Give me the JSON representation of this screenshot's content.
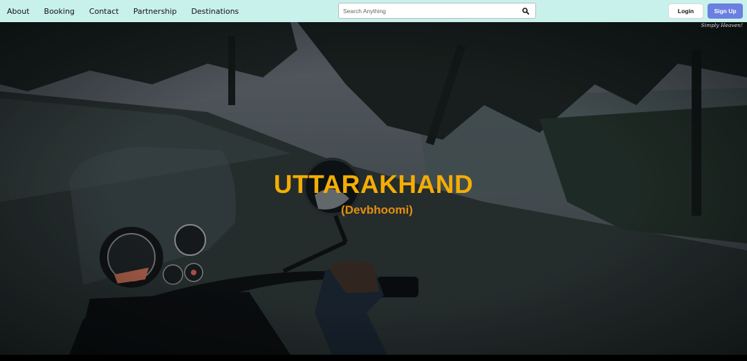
{
  "nav": {
    "links": [
      "About",
      "Booking",
      "Contact",
      "Partnership",
      "Destinations"
    ],
    "search_placeholder": "Search Anything",
    "search_icon": "magnifier",
    "login_label": "Login",
    "signup_label": "Sign Up"
  },
  "hero": {
    "tagline": "Simply Heaven!",
    "title": "UTTARAKHAND",
    "subtitle": "(Devbhoomi)"
  },
  "colors": {
    "navbar": "#c9f1ec",
    "signup": "#6a7fe0",
    "title": "#f3ad05",
    "subtitle": "#e58f0f"
  }
}
